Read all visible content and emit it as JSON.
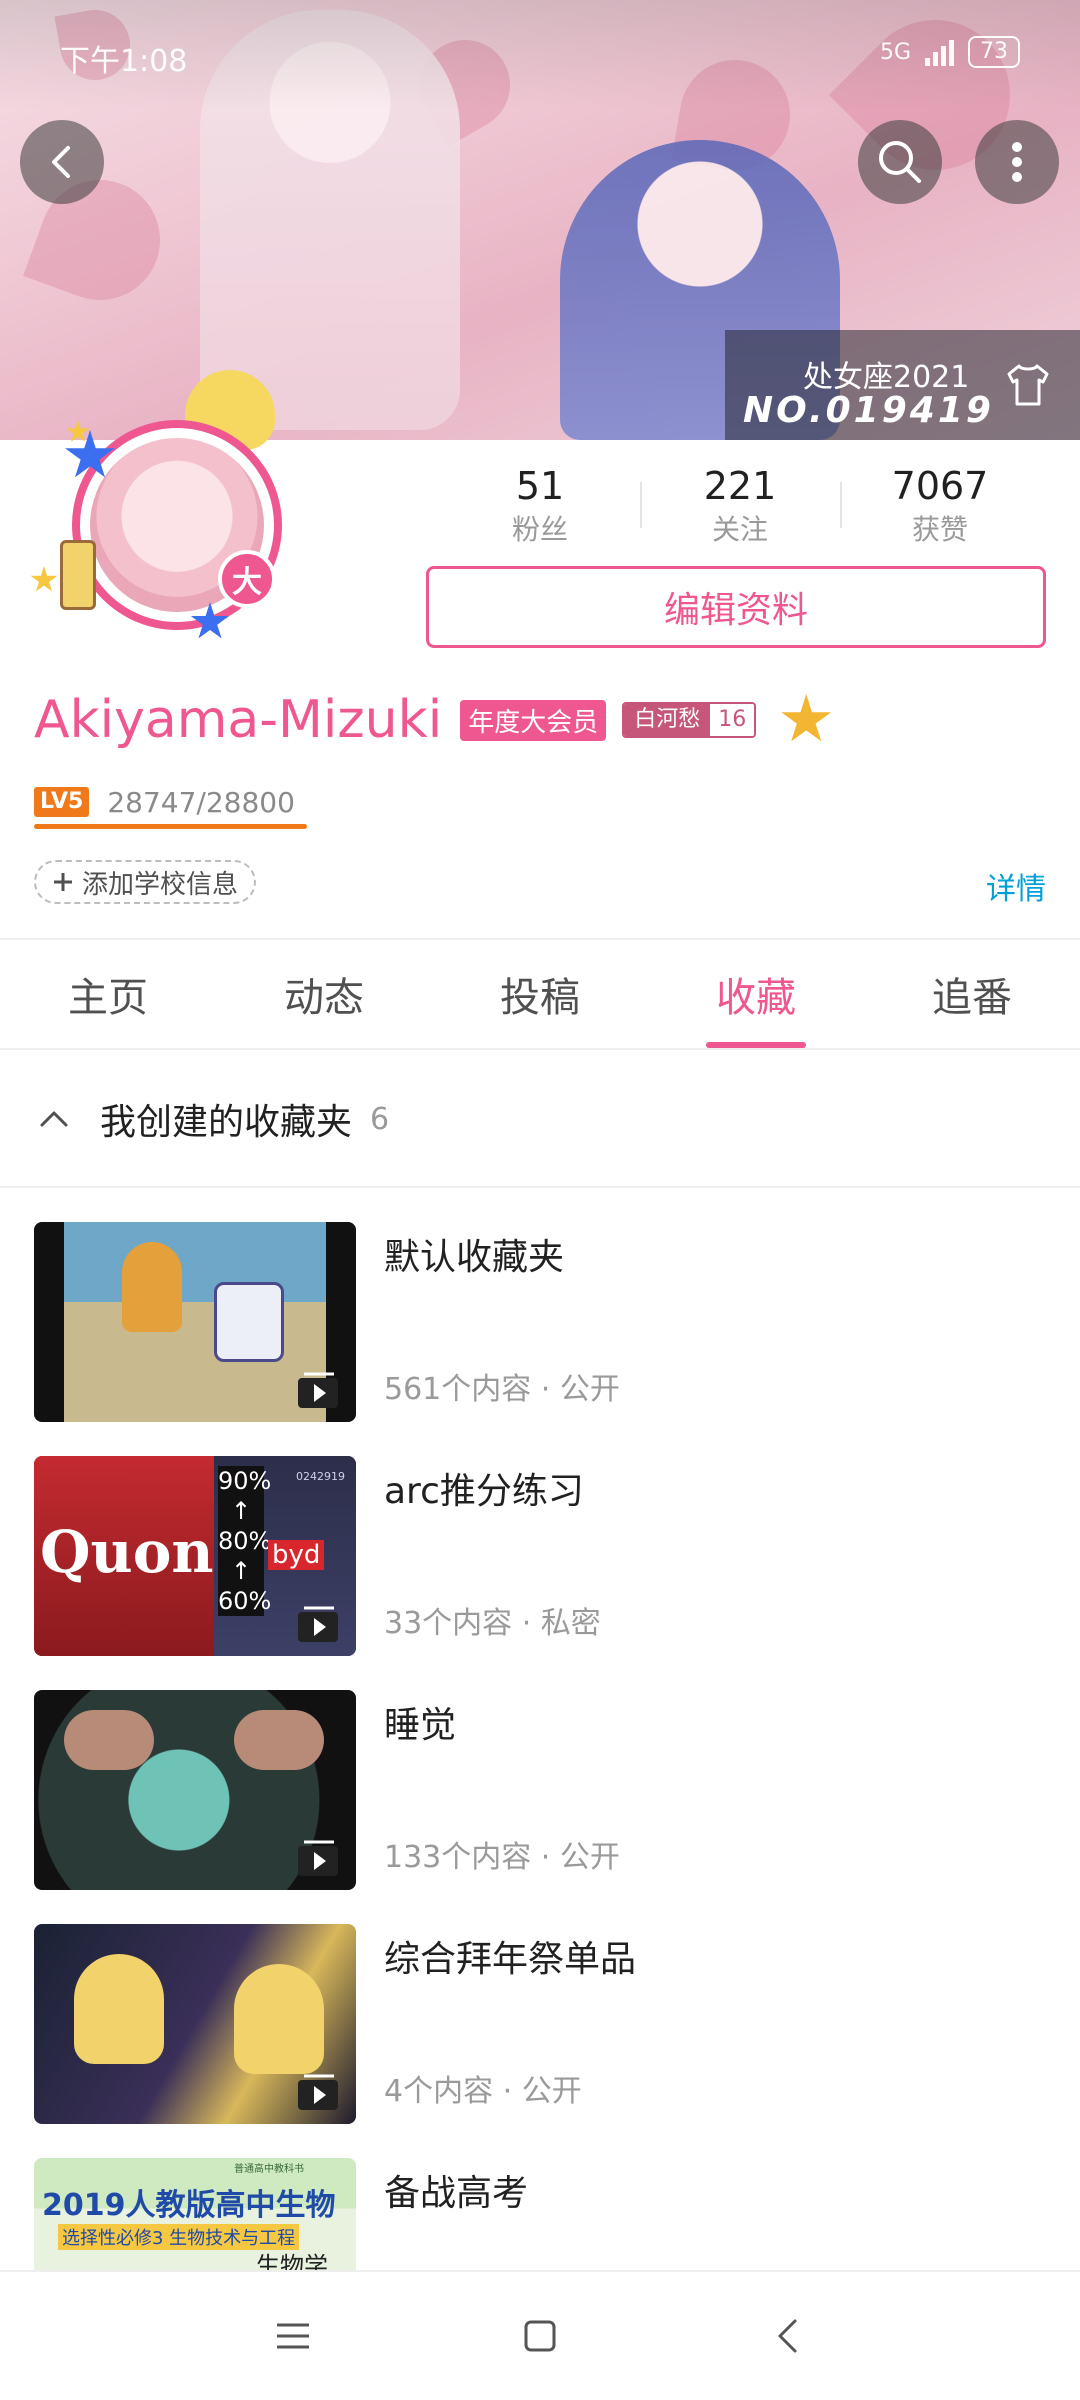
{
  "status_bar": {
    "time": "下午1:08",
    "network": "5G",
    "battery": "73"
  },
  "banner": {
    "zodiac": "处女座2021",
    "serial": "NO.019419"
  },
  "profile": {
    "avatar_badge": "大",
    "stats": [
      {
        "value": "51",
        "label": "粉丝"
      },
      {
        "value": "221",
        "label": "关注"
      },
      {
        "value": "7067",
        "label": "获赞"
      }
    ],
    "edit_button": "编辑资料",
    "username": "Akiyama-Mizuki",
    "vip_label": "年度大会员",
    "medal": {
      "name": "白河愁",
      "level": "16"
    },
    "level_badge": "LV5",
    "exp": "28747/28800",
    "exp_fraction": 0.998,
    "add_school": "添加学校信息",
    "details": "详情"
  },
  "tabs": [
    {
      "label": "主页",
      "active": false
    },
    {
      "label": "动态",
      "active": false
    },
    {
      "label": "投稿",
      "active": false
    },
    {
      "label": "收藏",
      "active": true
    },
    {
      "label": "追番",
      "active": false
    }
  ],
  "folders_section": {
    "title": "我创建的收藏夹",
    "count": "6",
    "items": [
      {
        "name": "默认收藏夹",
        "meta": "561个内容 · 公开"
      },
      {
        "name": "arc推分练习",
        "meta": "33个内容 · 私密",
        "thumb_text": {
          "brand": "Quon",
          "p1": "90%",
          "p2": "80%",
          "p3": "60%",
          "arrow": "↑",
          "tag": "byd",
          "code": "0242919"
        }
      },
      {
        "name": "睡觉",
        "meta": "133个内容 · 公开"
      },
      {
        "name": "综合拜年祭单品",
        "meta": "4个内容 · 公开"
      },
      {
        "name": "备战高考",
        "meta": "",
        "thumb_text": {
          "line1": "2019人教版高中生物",
          "line2": "选择性必修3  生物技术与工程",
          "line3": "生物学",
          "top": "普通高中教科书"
        }
      }
    ]
  },
  "colors": {
    "accent": "#ef5790",
    "link": "#00a1d6",
    "level": "#f07a1a"
  }
}
